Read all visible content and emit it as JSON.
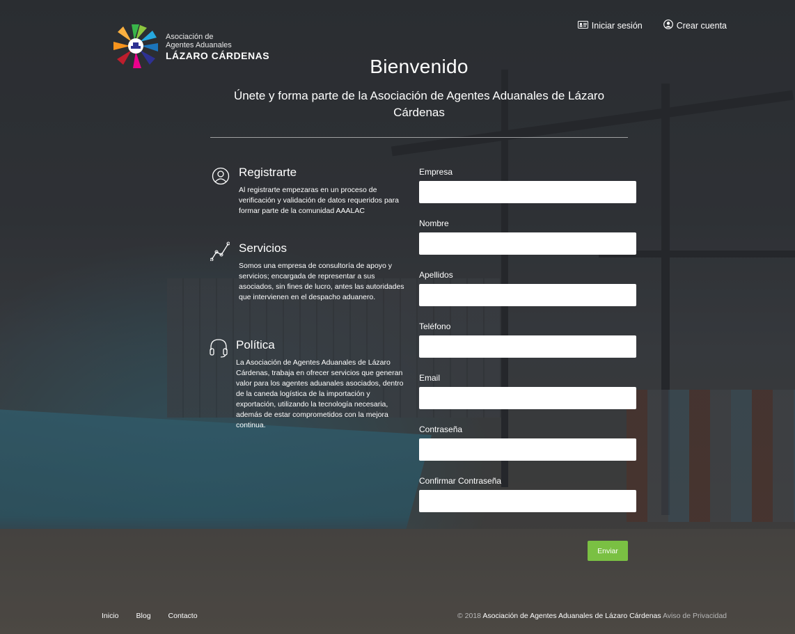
{
  "brand": {
    "line1": "Asociación de",
    "line2": "Agentes Aduanales",
    "line3": "LÁZARO CÁRDENAS"
  },
  "topnav": {
    "login": {
      "label": "Iniciar sesión",
      "icon": "id-card-icon"
    },
    "signup": {
      "label": "Crear cuenta",
      "icon": "user-circle-icon"
    }
  },
  "hero": {
    "title": "Bienvenido",
    "subtitle": "Únete y forma parte de la Asociación de Agentes Aduanales de Lázaro Cárdenas"
  },
  "features": [
    {
      "icon": "user-icon",
      "title": "Registrarte",
      "text": "Al registrarte empezaras en un proceso de verificación y validación de datos requeridos para formar parte de la comunidad AAALAC"
    },
    {
      "icon": "line-chart-icon",
      "title": "Servicios",
      "text": "Somos una empresa de consultoría de apoyo y servicios; encargada de representar a sus asociados, sin fines de lucro, antes las autoridades que intervienen en el despacho aduanero."
    },
    {
      "icon": "headset-icon",
      "title": "Política",
      "text": "La Asociación de Agentes Aduanales de Lázaro Cárdenas, trabaja en ofrecer servicios que generan valor para los agentes aduanales asociados, dentro de la caneda logística de la importación y exportación, utilizando la tecnología necesaria, además de estar comprometidos con la mejora continua."
    }
  ],
  "form": {
    "fields": [
      {
        "label": "Empresa",
        "value": ""
      },
      {
        "label": "Nombre",
        "value": ""
      },
      {
        "label": "Apellidos",
        "value": ""
      },
      {
        "label": "Teléfono",
        "value": ""
      },
      {
        "label": "Email",
        "value": ""
      },
      {
        "label": "Contraseña",
        "value": ""
      },
      {
        "label": "Confirmar Contraseña",
        "value": ""
      }
    ],
    "submit_label": "Enviar",
    "submit_color": "#7ac043"
  },
  "footer": {
    "links": [
      "Inicio",
      "Blog",
      "Contacto"
    ],
    "copyright": "© 2018",
    "org": "Asociación de Agentes Aduanales de Lázaro Cárdenas",
    "privacy": "Aviso de Privacidad"
  }
}
